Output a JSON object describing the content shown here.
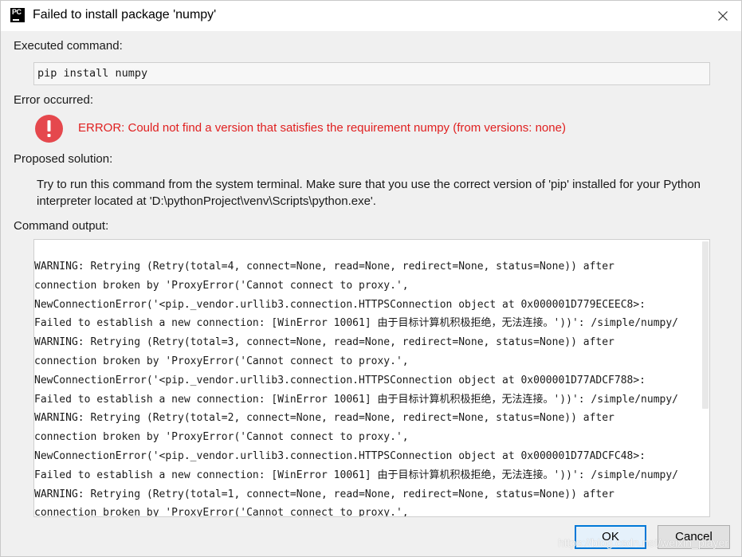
{
  "window": {
    "title": "Failed to install package 'numpy'",
    "app_icon_text": "PC"
  },
  "executed": {
    "label": "Executed command:",
    "command": "pip install numpy"
  },
  "error": {
    "label": "Error occurred:",
    "message": "ERROR: Could not find a version that satisfies the requirement numpy (from versions: none)",
    "color": "#e02020"
  },
  "solution": {
    "label": "Proposed solution:",
    "text": "Try to run this command from the system terminal. Make sure that you use the correct version of 'pip' installed for your Python interpreter located at 'D:\\pythonProject\\venv\\Scripts\\python.exe'."
  },
  "output": {
    "label": "Command output:",
    "lines": [
      "WARNING: Retrying (Retry(total=4, connect=None, read=None, redirect=None, status=None)) after",
      "connection broken by 'ProxyError('Cannot connect to proxy.',",
      "NewConnectionError('<pip._vendor.urllib3.connection.HTTPSConnection object at 0x000001D779ECEEC8>:",
      "Failed to establish a new connection: [WinError 10061] 由于目标计算机积极拒绝，无法连接。'))': /simple/numpy/",
      "WARNING: Retrying (Retry(total=3, connect=None, read=None, redirect=None, status=None)) after",
      "connection broken by 'ProxyError('Cannot connect to proxy.',",
      "NewConnectionError('<pip._vendor.urllib3.connection.HTTPSConnection object at 0x000001D77ADCF788>:",
      "Failed to establish a new connection: [WinError 10061] 由于目标计算机积极拒绝，无法连接。'))': /simple/numpy/",
      "WARNING: Retrying (Retry(total=2, connect=None, read=None, redirect=None, status=None)) after",
      "connection broken by 'ProxyError('Cannot connect to proxy.',",
      "NewConnectionError('<pip._vendor.urllib3.connection.HTTPSConnection object at 0x000001D77ADCFC48>:",
      "Failed to establish a new connection: [WinError 10061] 由于目标计算机积极拒绝，无法连接。'))': /simple/numpy/",
      "WARNING: Retrying (Retry(total=1, connect=None, read=None, redirect=None, status=None)) after",
      "connection broken by 'ProxyError('Cannot connect to proxy.',"
    ]
  },
  "buttons": {
    "ok": "OK",
    "cancel": "Cancel"
  },
  "watermark": "https://blog.csdn.net/weixin_player",
  "icons": {
    "error": "error-circle-icon",
    "close": "close-icon",
    "app": "pycharm-icon"
  },
  "colors": {
    "accent": "#0078d7",
    "error_icon": "#e5484d"
  }
}
